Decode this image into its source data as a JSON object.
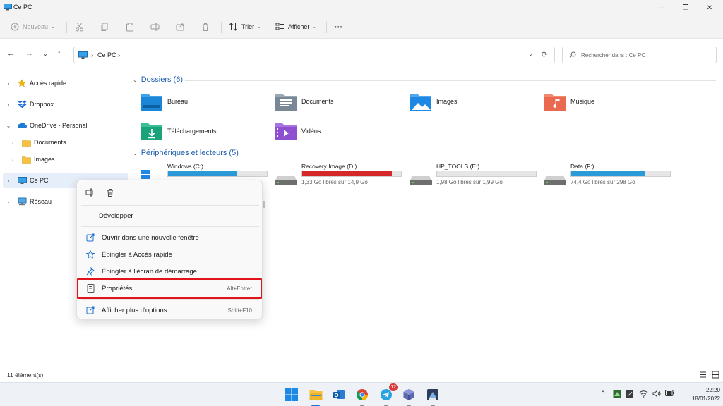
{
  "window": {
    "title": "Ce PC",
    "minimize_glyph": "—",
    "maximize_glyph": "❐",
    "close_glyph": "✕"
  },
  "toolbar": {
    "new_label": "Nouveau",
    "sort_label": "Trier",
    "view_label": "Afficher",
    "more_glyph": "•••"
  },
  "address": {
    "path": [
      "Ce PC"
    ],
    "search_placeholder": "Rechercher dans : Ce PC"
  },
  "sidebar": {
    "items": [
      {
        "label": "Accès rapide",
        "icon": "star-icon",
        "expander": "›"
      },
      {
        "label": "Dropbox",
        "icon": "dropbox-icon",
        "expander": "›"
      },
      {
        "label": "OneDrive - Personal",
        "icon": "cloud-icon",
        "expander": "⌄"
      },
      {
        "label": "Documents",
        "icon": "folder-icon",
        "expander": "›"
      },
      {
        "label": "Images",
        "icon": "folder-icon",
        "expander": "›"
      },
      {
        "label": "Ce PC",
        "icon": "pc-icon",
        "expander": "›"
      },
      {
        "label": "Réseau",
        "icon": "network-icon",
        "expander": "›"
      }
    ]
  },
  "content": {
    "folders_header": "Dossiers (6)",
    "folders": [
      {
        "name": "Bureau",
        "icon": "desktop-folder-icon",
        "color": "#2a8fd8"
      },
      {
        "name": "Documents",
        "icon": "documents-folder-icon",
        "color": "#7a8796"
      },
      {
        "name": "Images",
        "icon": "pictures-folder-icon",
        "color": "#1e88e5"
      },
      {
        "name": "Musique",
        "icon": "music-folder-icon",
        "color": "#e96a50"
      },
      {
        "name": "Téléchargements",
        "icon": "downloads-folder-icon",
        "color": "#1aa37a"
      },
      {
        "name": "Vidéos",
        "icon": "videos-folder-icon",
        "color": "#8e4fd1"
      }
    ],
    "devices_header": "Périphériques et lecteurs (5)",
    "drives": [
      {
        "name": "Windows (C:)",
        "used_fraction": 0.69,
        "bar_color": "#2b9ad9",
        "free_text": ""
      },
      {
        "name": "Recovery Image (D:)",
        "used_fraction": 0.91,
        "bar_color": "#d62828",
        "free_text": "1,33 Go libres sur 14,9 Go"
      },
      {
        "name": "HP_TOOLS (E:)",
        "used_fraction": 0.0,
        "bar_color": "#2b9ad9",
        "free_text": "1,98 Go libres sur 1,99 Go"
      },
      {
        "name": "Data (F:)",
        "used_fraction": 0.75,
        "bar_color": "#2b9ad9",
        "free_text": "74,4 Go libres sur 298 Go"
      }
    ]
  },
  "context_menu": {
    "items": [
      {
        "label": "Développer",
        "icon": "",
        "shortcut": ""
      },
      {
        "label": "Ouvrir dans une nouvelle fenêtre",
        "icon": "open-new-window-icon",
        "shortcut": ""
      },
      {
        "label": "Épingler à Accès rapide",
        "icon": "star-outline-icon",
        "shortcut": ""
      },
      {
        "label": "Épingler à l'écran de démarrage",
        "icon": "pin-icon",
        "shortcut": ""
      },
      {
        "label": "Propriétés",
        "icon": "properties-icon",
        "shortcut": "Alt+Entrer"
      },
      {
        "label": "Afficher plus d'options",
        "icon": "more-options-icon",
        "shortcut": "Shift+F10"
      }
    ]
  },
  "status": {
    "item_count": "11 élément(s)"
  },
  "taskbar": {
    "apps": [
      {
        "name": "start-icon"
      },
      {
        "name": "file-explorer-icon",
        "active": true
      },
      {
        "name": "outlook-icon"
      },
      {
        "name": "chrome-icon"
      },
      {
        "name": "telegram-icon",
        "badge": "12"
      },
      {
        "name": "virtualbox-icon"
      },
      {
        "name": "settings-app-icon"
      }
    ],
    "time": "22:20",
    "date": "18/01/2022"
  },
  "colors": {
    "accent": "#1f5fae",
    "selection": "#e6eefa",
    "highlight_box": "#e0141a",
    "drive_bar": "#2b9ad9",
    "drive_bar_low": "#d62828"
  }
}
